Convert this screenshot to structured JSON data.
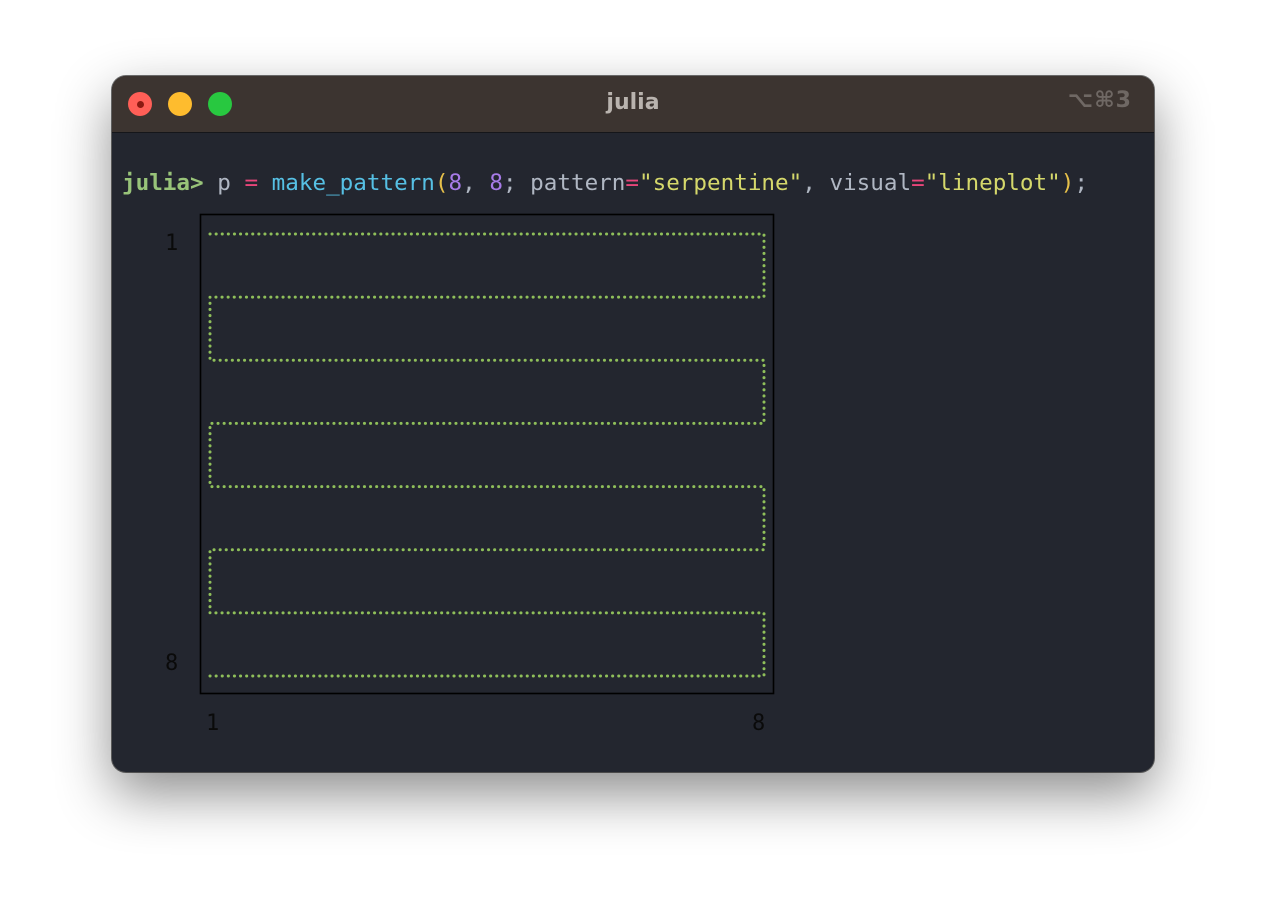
{
  "window": {
    "title": "julia",
    "shortcut": "⌥⌘3"
  },
  "command": {
    "prompt": "julia>",
    "var": "p",
    "assign": "=",
    "function": "make_pattern",
    "open_paren": "(",
    "arg1": "8",
    "comma1": ",",
    "arg2": "8",
    "semicolon": ";",
    "kw1": "pattern",
    "eq1": "=",
    "val1": "\"serpentine\"",
    "comma2": ",",
    "kw2": "visual",
    "eq2": "=",
    "val2": "\"lineplot\"",
    "close_paren": ")",
    "end": ";"
  },
  "colors": {
    "prompt": "#98c379",
    "function": "#56c0e4",
    "operator": "#e8467a",
    "number": "#a77be8",
    "string": "#d5d86b",
    "paren": "#e6c04a",
    "series": "#8fbf5a",
    "frame": "#000000"
  },
  "chart_data": {
    "type": "line",
    "style": "dotted",
    "xlim": [
      1,
      8
    ],
    "ylim": [
      1,
      8
    ],
    "y_inverted": true,
    "x_tick_labels": [
      "1",
      "8"
    ],
    "y_tick_labels": [
      "1",
      "8"
    ],
    "series": [
      {
        "x": [
          1,
          8,
          8,
          1,
          1,
          8,
          8,
          1,
          1,
          8,
          8,
          1,
          1,
          8,
          8,
          1
        ],
        "y": [
          1,
          1,
          2,
          2,
          3,
          3,
          4,
          4,
          5,
          5,
          6,
          6,
          7,
          7,
          8,
          8
        ]
      }
    ]
  }
}
